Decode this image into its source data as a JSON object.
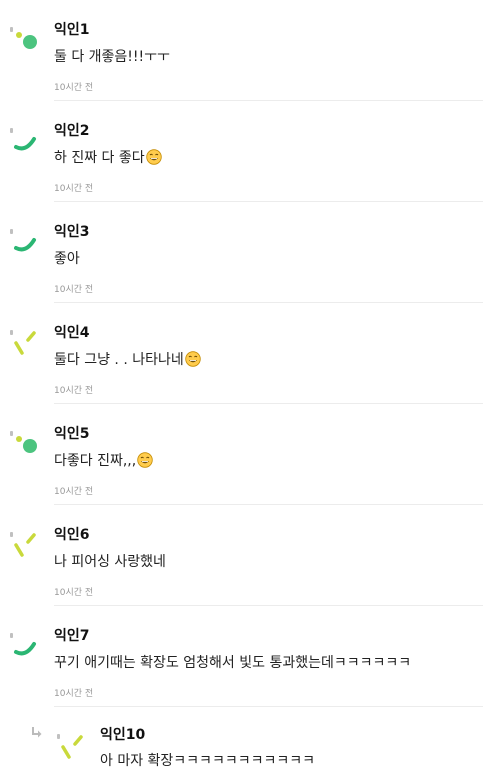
{
  "comments": [
    {
      "author": "익인1",
      "text": "둘 다 개좋음!!!ㅜㅜ",
      "time": "10시간 전",
      "avatar": "avatar-dot-circle",
      "emoji": false
    },
    {
      "author": "익인2",
      "text": "하 진짜 다 좋다",
      "time": "10시간 전",
      "avatar": "avatar-arc",
      "emoji": true
    },
    {
      "author": "익인3",
      "text": "좋아",
      "time": "10시간 전",
      "avatar": "avatar-arc",
      "emoji": false
    },
    {
      "author": "익인4",
      "text": "둘다 그냥 . . 나타나네",
      "time": "10시간 전",
      "avatar": "avatar-dashes",
      "emoji": true
    },
    {
      "author": "익인5",
      "text": "다좋다 진짜,,,",
      "time": "10시간 전",
      "avatar": "avatar-dot-circle",
      "emoji": true
    },
    {
      "author": "익인6",
      "text": "나 피어싱 사랑했네",
      "time": "10시간 전",
      "avatar": "avatar-dashes",
      "emoji": false
    },
    {
      "author": "익인7",
      "text": "꾸기 애기때는 확장도 엄청해서 빛도 통과했는데ㅋㅋㅋㅋㅋㅋ",
      "time": "10시간 전",
      "avatar": "avatar-arc",
      "emoji": false
    }
  ],
  "reply": {
    "author": "익인10",
    "text": "아 마자 확장ㅋㅋㅋㅋㅋㅋㅋㅋㅋㅋㅋ",
    "avatar": "avatar-dashes",
    "icon": "reply-arrow-icon"
  },
  "colors": {
    "green": "#2bb673",
    "lime": "#c9d93b",
    "dot_green": "#4cc47f",
    "time_gray": "#999999",
    "divider": "#ececec"
  }
}
